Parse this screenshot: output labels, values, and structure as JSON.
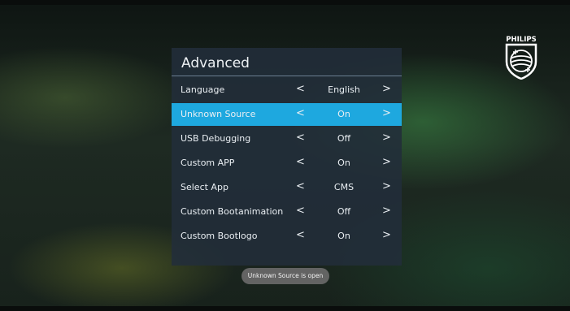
{
  "panel": {
    "title": "Advanced",
    "rows": [
      {
        "label": "Language",
        "value": "English",
        "selected": false
      },
      {
        "label": "Unknown Source",
        "value": "On",
        "selected": true
      },
      {
        "label": "USB Debugging",
        "value": "Off",
        "selected": false
      },
      {
        "label": "Custom APP",
        "value": "On",
        "selected": false
      },
      {
        "label": "Select App",
        "value": "CMS",
        "selected": false
      },
      {
        "label": "Custom Bootanimation",
        "value": "Off",
        "selected": false
      },
      {
        "label": "Custom Bootlogo",
        "value": "On",
        "selected": false
      }
    ],
    "arrow_left": "<",
    "arrow_right": ">"
  },
  "toast": {
    "text": "Unknown Source is open"
  },
  "logo": {
    "brand": "PHILIPS",
    "icon": "philips-shield-logo"
  },
  "colors": {
    "selected": "#1ea8df",
    "panel": "#222e3a"
  }
}
